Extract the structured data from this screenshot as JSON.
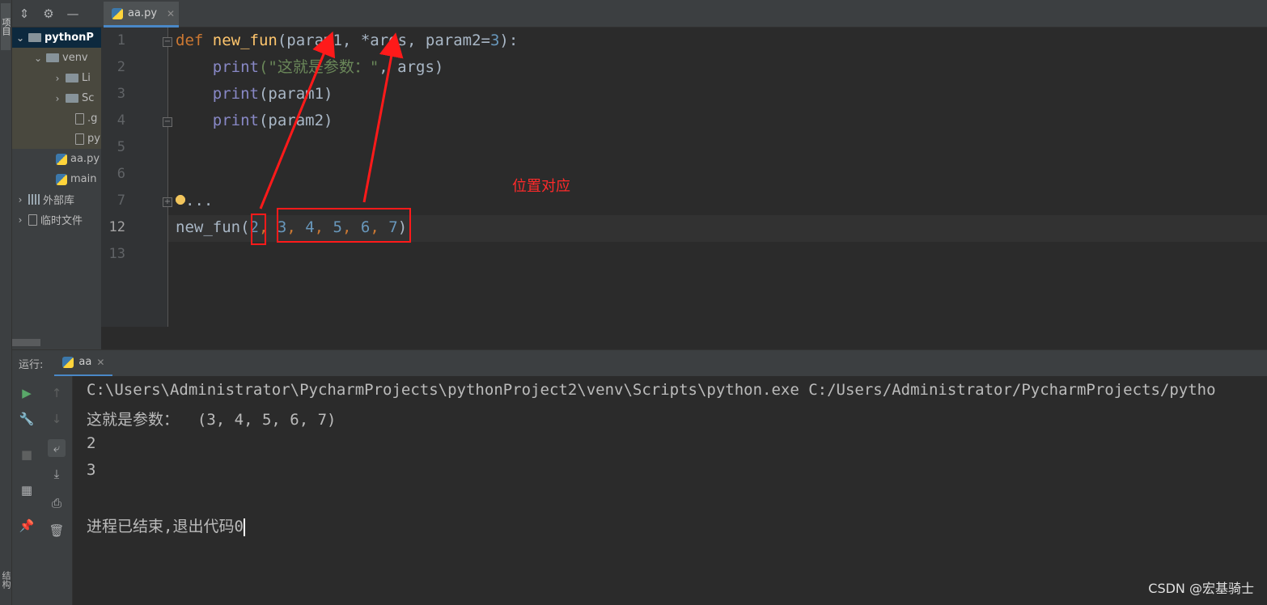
{
  "tool_strip": {
    "top_label": "项目",
    "bottom_label": "结构"
  },
  "project": {
    "toolbar_icons": [
      "collapse-icon",
      "gear-icon",
      "minimize-icon"
    ],
    "tree": [
      {
        "label": "pythonP",
        "icon": "folder-icon",
        "expanded": true
      },
      {
        "label": "venv",
        "icon": "folder-icon",
        "expanded": true
      },
      {
        "label": "Li",
        "icon": "folder-icon",
        "expanded": false
      },
      {
        "label": "Sc",
        "icon": "folder-icon",
        "expanded": false
      },
      {
        "label": ".g",
        "icon": "ignore-file-icon"
      },
      {
        "label": "py",
        "icon": "text-file-icon"
      },
      {
        "label": "aa.py",
        "icon": "python-file-icon"
      },
      {
        "label": "main",
        "icon": "python-file-icon"
      },
      {
        "label": "外部库",
        "icon": "library-icon",
        "expanded": false
      },
      {
        "label": "临时文件",
        "icon": "scratch-icon",
        "expanded": false
      }
    ]
  },
  "editor": {
    "tab_label": "aa.py",
    "line_numbers": [
      "1",
      "2",
      "3",
      "4",
      "5",
      "6",
      "7",
      "12",
      "13"
    ],
    "current_line": "12",
    "code": {
      "l1_def": "def",
      "l1_name": "new_fun",
      "l1_open": "(param1, ",
      "l1_star": "*args, param2=",
      "l1_num": "3",
      "l1_close": "):",
      "l2_print": "print",
      "l2_str": "(\"这就是参数：\"",
      "l2_rest": ", args)",
      "l3_print": "print",
      "l3_rest": "(param1)",
      "l4_print": "print",
      "l4_rest": "(param2)",
      "l7_dots": "...",
      "l12_name": "new_fun(",
      "l12_args": [
        "2",
        "3",
        "4",
        "5",
        "6",
        "7"
      ],
      "l12_close": ")"
    },
    "annotation": "位置对应",
    "annotation_color": "#ff2a2a"
  },
  "run": {
    "label": "运行:",
    "tab_label": "aa",
    "output": [
      "C:\\Users\\Administrator\\PycharmProjects\\pythonProject2\\venv\\Scripts\\python.exe C:/Users/Administrator/PycharmProjects/pytho",
      "这就是参数：  (3, 4, 5, 6, 7)",
      "2",
      "3",
      "",
      "进程已结束,退出代码0"
    ]
  },
  "watermark": "CSDN @宏基骑士",
  "colors": {
    "accent": "#4a88c7",
    "keyword": "#cc7832",
    "function": "#ffc66d",
    "builtin": "#8888c6",
    "string": "#6a8759",
    "number": "#6897bb"
  }
}
